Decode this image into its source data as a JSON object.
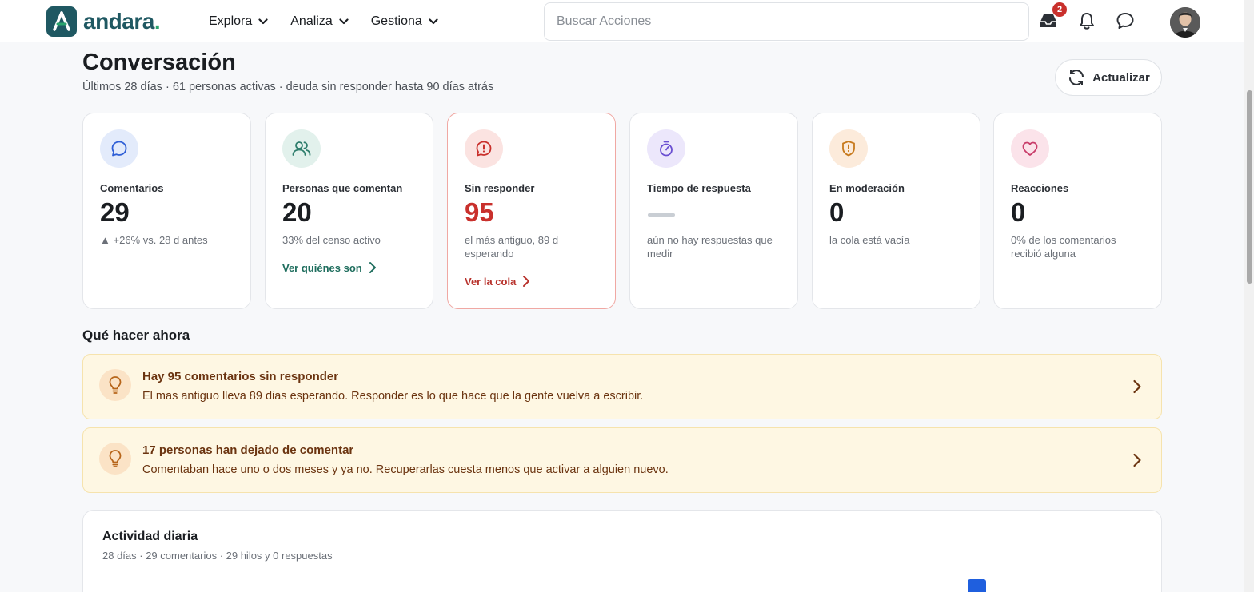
{
  "app": {
    "brand": "andara",
    "brand_dot": "."
  },
  "nav": {
    "items": [
      {
        "label": "Explora"
      },
      {
        "label": "Analiza"
      },
      {
        "label": "Gestiona"
      }
    ]
  },
  "search": {
    "placeholder": "Buscar Acciones"
  },
  "header_icons": {
    "inbox_badge": "2",
    "icons": [
      "inbox-icon",
      "bell-icon",
      "chat-icon"
    ]
  },
  "page": {
    "title": "Conversación",
    "subtitle": "Últimos 28 días · 61 personas activas · deuda sin responder hasta 90 días atrás",
    "refresh_label": "Actualizar"
  },
  "cards": [
    {
      "label": "Comentarios",
      "value": "29",
      "trend_symbol": "▲",
      "note": "+26% vs. 28 d antes",
      "icon": "comment-icon",
      "accent": "#2f5fd6"
    },
    {
      "label": "Personas que comentan",
      "value": "20",
      "note": "33% del censo activo",
      "link": "Ver quiénes son",
      "icon": "users-icon",
      "accent": "#2e7d6c"
    },
    {
      "label": "Sin responder",
      "value": "95",
      "note": "el más antiguo, 89 d esperando",
      "link": "Ver la cola",
      "icon": "alert-comment-icon",
      "accent": "#c9302c"
    },
    {
      "label": "Tiempo de respuesta",
      "value": "",
      "note": "aún no hay respuestas que medir",
      "icon": "stopwatch-icon",
      "accent": "#6a4fd1"
    },
    {
      "label": "En moderación",
      "value": "0",
      "note": "la cola está vacía",
      "icon": "shield-alert-icon",
      "accent": "#c77a1d"
    },
    {
      "label": "Reacciones",
      "value": "0",
      "note": "0% de los comentarios recibió alguna",
      "icon": "heart-icon",
      "accent": "#c93d6a"
    }
  ],
  "actions": {
    "title": "Qué hacer ahora",
    "items": [
      {
        "title": "Hay 95 comentarios sin responder",
        "body": "El mas antiguo lleva 89 dias esperando. Responder es lo que hace que la gente vuelva a escribir.",
        "icon": "lightbulb-icon"
      },
      {
        "title": "17 personas han dejado de comentar",
        "body": "Comentaban hace uno o dos meses y ya no. Recuperarlas cuesta menos que activar a alguien nuevo.",
        "icon": "lightbulb-icon"
      }
    ]
  },
  "activity": {
    "title": "Actividad diaria",
    "subtitle": "28 días · 29 comentarios · 29 hilos y 0 respuestas",
    "bar_color": "#1f5fde"
  }
}
